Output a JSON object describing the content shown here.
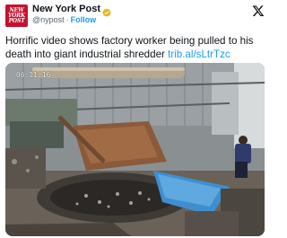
{
  "author": {
    "display_name": "New York Post",
    "handle": "@nypost",
    "follow_label": "Follow",
    "separator": "·",
    "avatar_lines": [
      "NEW",
      "YORK",
      "POST"
    ],
    "avatar_color": "#c8102e",
    "verified_badge": "gold-verified-icon"
  },
  "tweet": {
    "text": "Horrific video shows factory worker being pulled to his death into giant industrial shredder ",
    "link_text": "trib.al/sLtrTzc"
  },
  "media": {
    "timestamp": "06:11:16"
  },
  "colors": {
    "link": "#1d9bf0",
    "text": "#0f1419",
    "muted": "#536471"
  },
  "icons": {
    "platform": "x-logo-icon"
  }
}
